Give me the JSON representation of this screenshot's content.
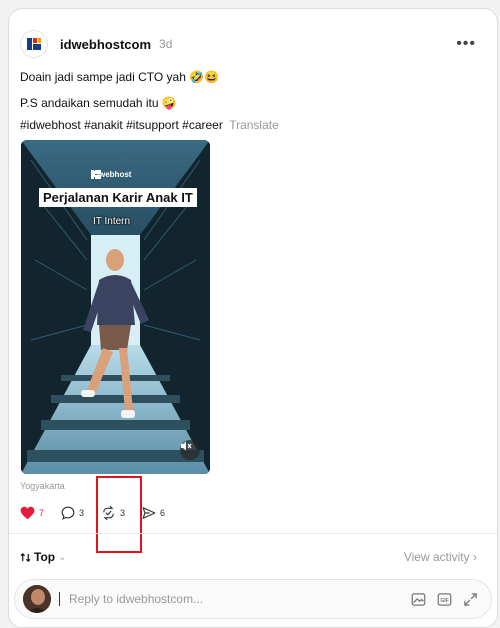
{
  "post": {
    "username": "idwebhostcom",
    "time": "3d",
    "more_label": "•••",
    "text_line1": "Doain jadi sampe jadi CTO yah 🤣😆",
    "text_line2": "P.S andaikan semudah itu 🤪",
    "hashtags": [
      "#idwebhost",
      "#anakit",
      "#itsupport",
      "#career"
    ],
    "translate_label": "Translate",
    "location": "Yogyakarta"
  },
  "video": {
    "logo_text": "IDwebhost",
    "title": "Perjalanan Karir Anak IT",
    "subtitle": "IT Intern",
    "mute_icon": "speaker-muted-icon"
  },
  "actions": {
    "likes": "7",
    "comments": "3",
    "reposts": "3",
    "shares": "6",
    "like_color": "#e21e3c"
  },
  "replies": {
    "sort_label": "Top",
    "view_activity": "View activity",
    "view_activity_arrow": "›",
    "reply_placeholder": "Reply to idwebhostcom..."
  },
  "colors": {
    "highlight_box": "#e0141e",
    "muted_text": "#999999"
  }
}
